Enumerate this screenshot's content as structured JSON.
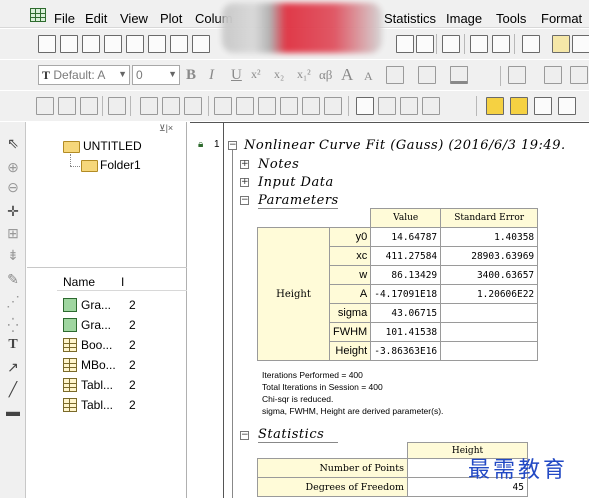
{
  "menu": {
    "items": [
      "File",
      "Edit",
      "View",
      "Plot",
      "Colum",
      "Statistics",
      "Image",
      "Tools",
      "Format"
    ]
  },
  "format_bar": {
    "font_label": "Default: A",
    "size_value": "0",
    "glyphs": [
      "B",
      "I",
      "U",
      "x²",
      "x₂",
      "x₁²",
      "αβ",
      "A",
      "A"
    ]
  },
  "explorer": {
    "root_folder": "UNTITLED",
    "child_folder": "Folder1",
    "col_name": "Name",
    "col_second": "I",
    "items": [
      {
        "name": "Gra...",
        "val": "2",
        "icon": "graph-icon"
      },
      {
        "name": "Gra...",
        "val": "2",
        "icon": "graph-icon"
      },
      {
        "name": "Boo...",
        "val": "2",
        "icon": "workbook-icon"
      },
      {
        "name": "MBo...",
        "val": "2",
        "icon": "matrix-book-icon"
      },
      {
        "name": "Tabl...",
        "val": "2",
        "icon": "table-icon"
      },
      {
        "name": "Tabl...",
        "val": "2",
        "icon": "table-icon"
      }
    ]
  },
  "sheet": {
    "lock_index": "1",
    "title": "Nonlinear Curve Fit (Gauss) (2016/6/3 19:49.",
    "notes": "Notes",
    "input_data": "Input Data",
    "parameters": "Parameters",
    "statistics": "Statistics",
    "params_table": {
      "col_value": "Value",
      "col_error": "Standard Error",
      "group": "Height",
      "rows": [
        {
          "name": "y0",
          "value": "14.64787",
          "error": "1.40358"
        },
        {
          "name": "xc",
          "value": "411.27584",
          "error": "28903.63969"
        },
        {
          "name": "w",
          "value": "86.13429",
          "error": "3400.63657"
        },
        {
          "name": "A",
          "value": "-4.17091E18",
          "error": "1.20606E22"
        },
        {
          "name": "sigma",
          "value": "43.06715",
          "error": ""
        },
        {
          "name": "FWHM",
          "value": "101.41538",
          "error": ""
        },
        {
          "name": "Height",
          "value": "-3.86363E16",
          "error": ""
        }
      ]
    },
    "notes_lines": [
      "Iterations Performed = 400",
      "Total Iterations in Session = 400",
      "Chi-sqr is reduced.",
      "sigma, FWHM, Height are derived parameter(s)."
    ],
    "stats_table": {
      "col": "Height",
      "rows": [
        {
          "name": "Number of Points",
          "value": ""
        },
        {
          "name": "Degrees of Freedom",
          "value": "45"
        }
      ]
    }
  },
  "watermark": "最需教育",
  "colors": {
    "header_yellow": "#fffbd8",
    "watermark_blue": "#2249c4",
    "toolbar_bg": "#f0f0f0"
  }
}
